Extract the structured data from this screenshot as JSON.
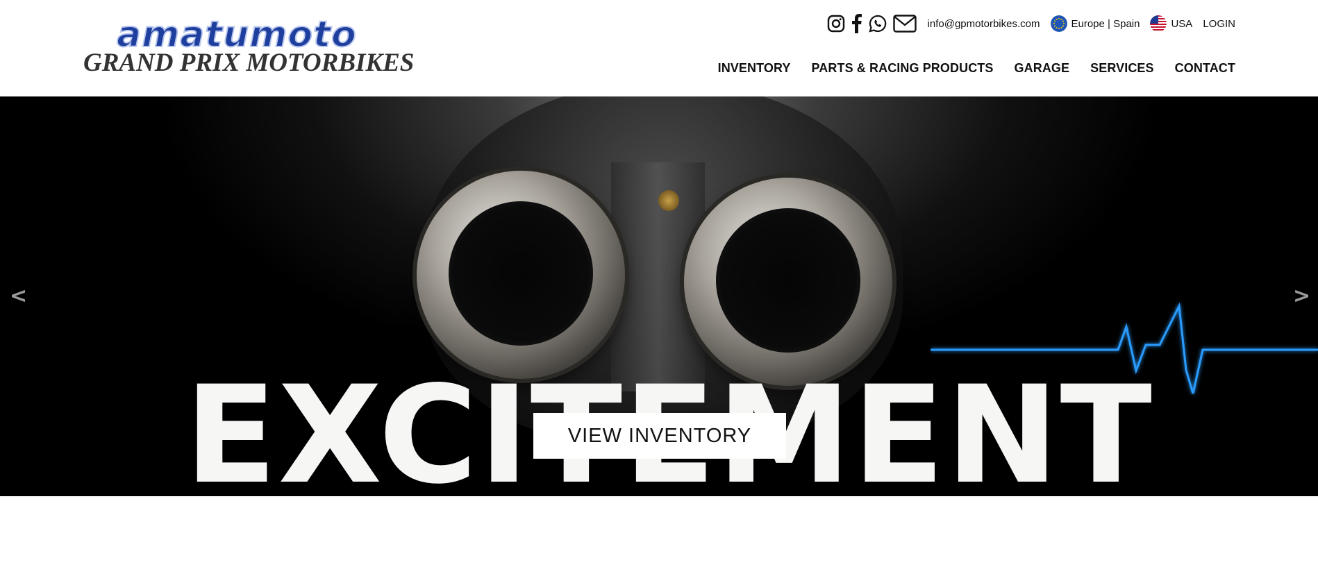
{
  "header": {
    "logo": {
      "top_text": "amatumoto",
      "bottom_text": "GRAND PRIX MOTORBIKES"
    },
    "topbar": {
      "social_icons": [
        "instagram-icon",
        "facebook-icon",
        "whatsapp-icon",
        "mail-icon"
      ],
      "email": "info@gpmotorbikes.com",
      "region_europe": "Europe | Spain",
      "region_usa": "USA",
      "login": "LOGIN"
    },
    "nav": {
      "items": [
        {
          "label": "INVENTORY"
        },
        {
          "label": "PARTS & RACING PRODUCTS"
        },
        {
          "label": "GARAGE"
        },
        {
          "label": "SERVICES"
        },
        {
          "label": "CONTACT"
        }
      ]
    }
  },
  "hero": {
    "headline": "EXCITEMENT",
    "button_label": "VIEW INVENTORY",
    "prev_label": "<",
    "next_label": ">",
    "accent_color": "#1e90ff"
  },
  "colors": {
    "logo_blue": "#1e3f9e",
    "logo_gray": "#333333",
    "nav_text": "#111111",
    "hero_bg": "#000000"
  }
}
